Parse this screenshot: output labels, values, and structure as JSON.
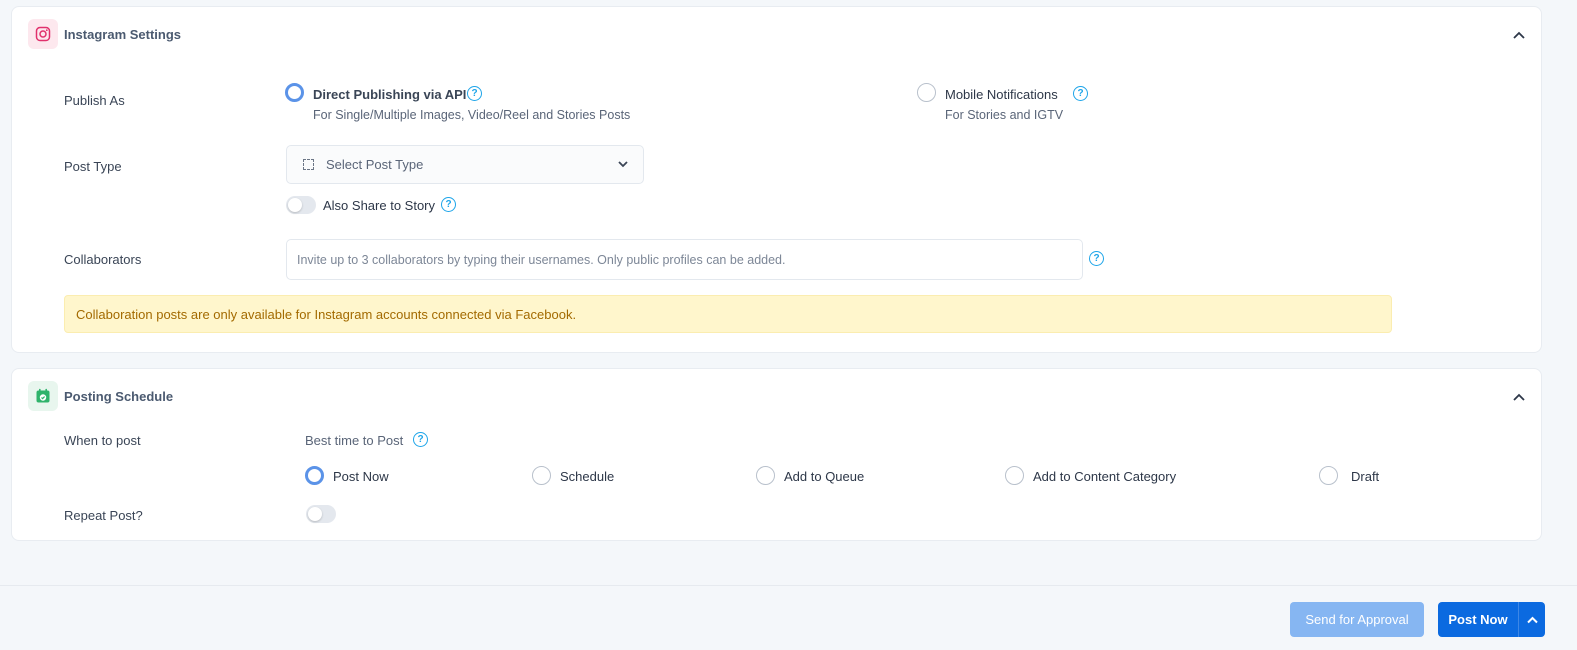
{
  "instagram_settings": {
    "title": "Instagram Settings",
    "publish_as": {
      "label": "Publish As",
      "options": [
        {
          "label": "Direct Publishing via API",
          "sub": "For Single/Multiple Images, Video/Reel and Stories Posts",
          "selected": true
        },
        {
          "label": "Mobile Notifications",
          "sub": "For Stories and IGTV",
          "selected": false
        }
      ]
    },
    "post_type": {
      "label": "Post Type",
      "placeholder": "Select Post Type"
    },
    "share_to_story": {
      "label": "Also Share to Story",
      "enabled": false
    },
    "collaborators": {
      "label": "Collaborators",
      "placeholder": "Invite up to 3 collaborators by typing their usernames. Only public profiles can be added."
    },
    "alert": "Collaboration posts are only available for Instagram accounts connected via Facebook."
  },
  "posting_schedule": {
    "title": "Posting Schedule",
    "when_to_post": {
      "label": "When to post",
      "best_time": "Best time to Post",
      "options": [
        {
          "label": "Post Now",
          "selected": true
        },
        {
          "label": "Schedule",
          "selected": false
        },
        {
          "label": "Add to Queue",
          "selected": false
        },
        {
          "label": "Add to Content Category",
          "selected": false
        },
        {
          "label": "Draft",
          "selected": false
        }
      ]
    },
    "repeat_post": {
      "label": "Repeat Post?",
      "enabled": false
    }
  },
  "footer": {
    "send_for_approval": "Send for Approval",
    "post_now": "Post Now"
  },
  "help_glyph": "?",
  "colors": {
    "accent": "#0b6ae0",
    "accent_light": "#86b6f2",
    "help": "#1ea5e9",
    "radio_selected": "#5b93e8",
    "alert_bg": "#fff6cc",
    "alert_text": "#a36a00",
    "instagram": "#e1306c",
    "calendar": "#2fb36b"
  },
  "icons": {
    "instagram": "instagram-icon",
    "calendar": "calendar-check-icon",
    "collapse": "chevron-up-icon",
    "dropdown": "chevron-down-icon",
    "help": "help-circle-icon"
  }
}
